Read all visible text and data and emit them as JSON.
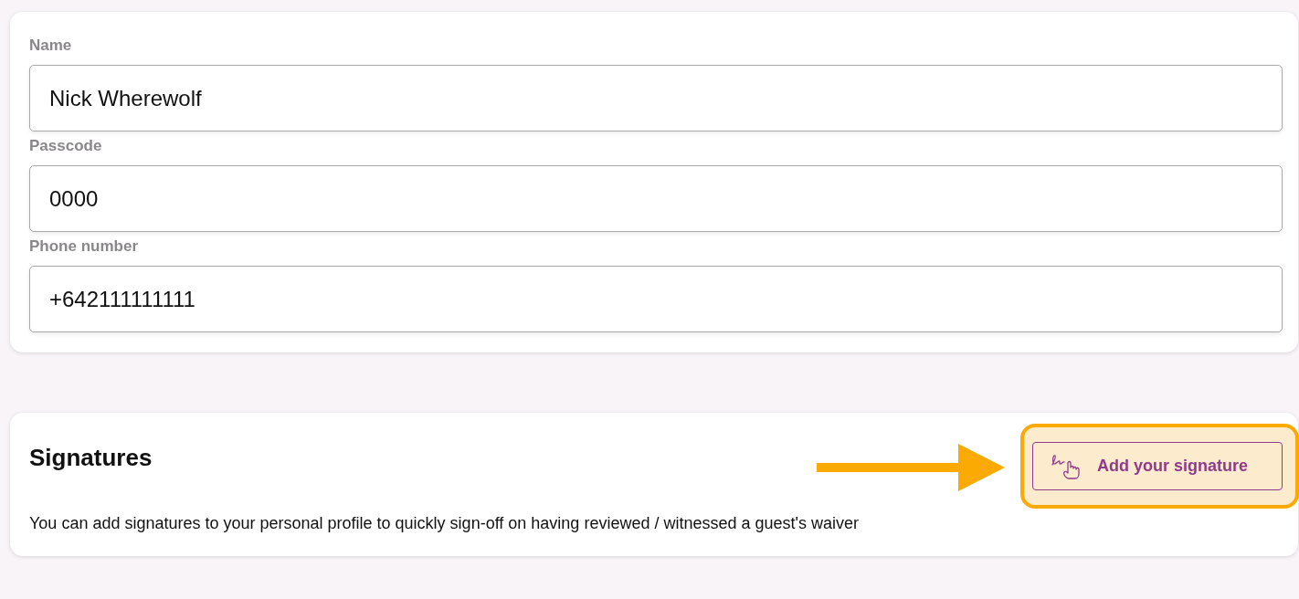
{
  "profile_form": {
    "fields": [
      {
        "label": "Name",
        "value": "Nick Wherewolf"
      },
      {
        "label": "Passcode",
        "value": "0000"
      },
      {
        "label": "Phone number",
        "value": "+642111111111"
      }
    ]
  },
  "signatures": {
    "title": "Signatures",
    "add_button": {
      "label": "Add your signature",
      "highlighted": true
    },
    "description": "You can add signatures to your personal profile to quickly sign-off on having reviewed / witnessed a guest's waiver"
  }
}
